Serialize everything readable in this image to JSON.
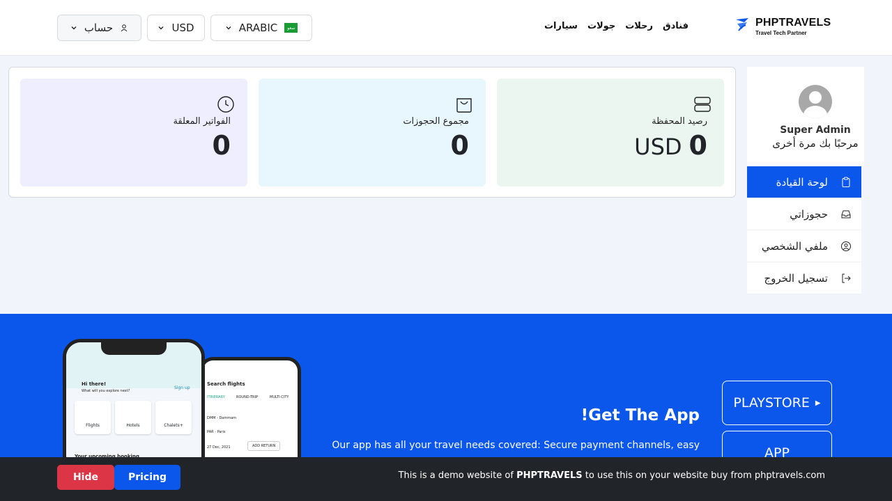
{
  "header": {
    "logo_title": "PHPTRAVELS",
    "logo_subtitle": "Travel Tech Partner",
    "nav": [
      "فنادق",
      "رحلات",
      "جولات",
      "سيارات"
    ],
    "language": "ARABIC",
    "flag_text": "سعو",
    "currency": "USD",
    "account": "حساب"
  },
  "profile": {
    "name": "Super Admin",
    "welcome": "مرحبًا بك مرة أخرى"
  },
  "sidebar": {
    "items": [
      {
        "label": "لوحة القيادة",
        "icon": "clipboard-icon",
        "active": true
      },
      {
        "label": "حجوزاتي",
        "icon": "inbox-icon",
        "active": false
      },
      {
        "label": "ملفي الشخصي",
        "icon": "user-circle-icon",
        "active": false
      },
      {
        "label": "تسجيل الخروج",
        "icon": "logout-icon",
        "active": false
      }
    ]
  },
  "stats": {
    "wallet": {
      "label": "رصيد المحفظة",
      "value": "0",
      "currency": "USD",
      "icon": "server-icon"
    },
    "bookings": {
      "label": "مجموع الحجوزات",
      "value": "0",
      "icon": "shopping-bag-icon"
    },
    "pending": {
      "label": "الفواتير المعلقة",
      "value": "0",
      "icon": "clock-icon"
    }
  },
  "banner": {
    "title": "!Get The App",
    "description": "Our app has all your travel needs covered: Secure payment channels, easy",
    "store_button_1": "PLAYSTORE",
    "store_button_2": "APP",
    "phone": {
      "greeting": "Hi there!",
      "question": "What will you explore next?",
      "signup": "Sign up",
      "tiles": [
        "Flights",
        "Hotels",
        "Chalets+"
      ],
      "upcoming": "Your upcoming booking",
      "search_title": "Search flights",
      "tabs": [
        "ITINERARY",
        "ROUND-TRIP",
        "MULTI-CITY"
      ],
      "from": "DMM - Dammam",
      "to": "PAR - Paris",
      "date": "27 Dec, 2021",
      "add_return": "ADD RETURN"
    }
  },
  "demo_bar": {
    "text_prefix": "This is a demo website of",
    "text_brand": "PHPTRAVELS",
    "text_suffix": "to use this on your website buy from phptravels.com",
    "hide": "Hide",
    "pricing": "Pricing"
  },
  "colors": {
    "primary": "#0b57eb",
    "danger": "#dc3545",
    "dark": "#212529",
    "wallet_bg": "#ecf6f1",
    "bookings_bg": "#e8f6fd",
    "pending_bg": "#efeefe"
  }
}
